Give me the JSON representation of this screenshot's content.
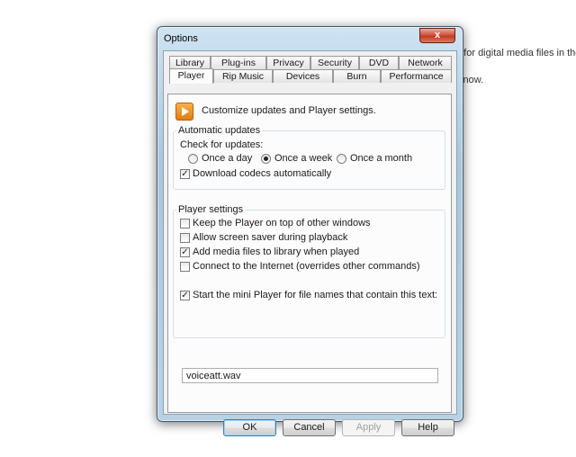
{
  "background": {
    "line1": "g for digital media files in the l",
    "line2": "y now."
  },
  "dialog": {
    "title": "Options",
    "close_glyph": "x",
    "tabs_row1": [
      "Library",
      "Plug-ins",
      "Privacy",
      "Security",
      "DVD",
      "Network"
    ],
    "tabs_row2": [
      "Player",
      "Rip Music",
      "Devices",
      "Burn",
      "Performance"
    ],
    "active_tab": "Player",
    "header_text": "Customize updates and Player settings.",
    "auto_updates": {
      "group_label": "Automatic updates",
      "check_label": "Check for updates:",
      "options": [
        "Once a day",
        "Once a week",
        "Once a month"
      ],
      "selected": "Once a week",
      "download_codecs_label": "Download codecs automatically",
      "download_codecs_checked": true
    },
    "player_settings": {
      "group_label": "Player settings",
      "items": [
        {
          "label": "Keep the Player on top of other windows",
          "checked": false
        },
        {
          "label": "Allow screen saver during playback",
          "checked": false
        },
        {
          "label": "Add media files to library when played",
          "checked": true
        },
        {
          "label": "Connect to the Internet (overrides other commands)",
          "checked": false
        }
      ],
      "mini_player_label": "Start the mini Player for file names that contain this text:",
      "mini_player_checked": true,
      "mini_player_value": "voiceatt.wav"
    },
    "buttons": {
      "ok": "OK",
      "cancel": "Cancel",
      "apply": "Apply",
      "help": "Help"
    }
  }
}
